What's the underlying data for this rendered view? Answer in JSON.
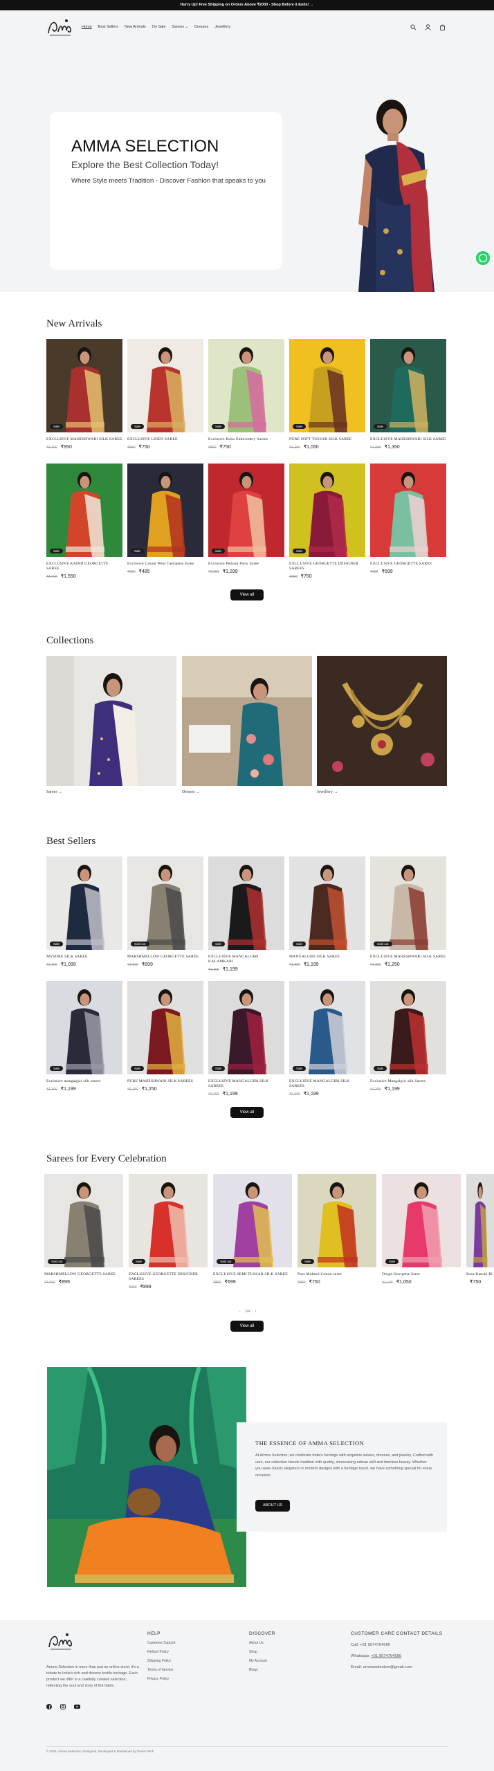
{
  "announcement": "Hurry Up! Free Shipping on Orders Above ₹2000 - Shop Before it Ends! →",
  "header": {
    "logo_text": "Amma Selection",
    "nav": [
      "Home",
      "Best Sellers",
      "New Arrivals",
      "On Sale",
      "Sarees",
      "Dresses",
      "Jewellery"
    ],
    "icons": [
      "search-icon",
      "account-icon",
      "cart-icon"
    ]
  },
  "hero": {
    "title": "AMMA SELECTION",
    "subtitle": "Explore the Best Collection Today!",
    "description": "Where Style meets Tradition - Discover Fashion that speaks to you"
  },
  "new_arrivals": {
    "title": "New Arrivals",
    "view_all": "View all",
    "products": [
      {
        "name": "EXCLUSIVE MAHESHWARI SILK SAREE",
        "old": "₹1,200",
        "price": "₹950",
        "badge": "Sale"
      },
      {
        "name": "EXCLUSIVE LINEN SAREE",
        "old": "₹850",
        "price": "₹750",
        "badge": "Sale"
      },
      {
        "name": "Exclusive Boho Embroidery Sarees",
        "old": "₹850",
        "price": "₹750",
        "badge": "Sale"
      },
      {
        "name": "PURE SOFT TUSSAR SILK SAREE",
        "old": "₹1,200",
        "price": "₹1,050",
        "badge": "Sale"
      },
      {
        "name": "EXCLUSIVE MAHESHWARI SILK SAREE",
        "old": "₹1,550",
        "price": "₹1,350",
        "badge": "Sale"
      },
      {
        "name": "EXCLUSIVE KADDI GEORGETTE SAREE",
        "old": "₹1,700",
        "price": "₹1,550",
        "badge": "Sale"
      },
      {
        "name": "Exclusive Casual Wear Georgette Saree",
        "old": "₹650",
        "price": "₹485",
        "badge": "Sale"
      },
      {
        "name": "Exclusive Pethani Party Saree",
        "old": "₹1,350",
        "price": "₹1,299",
        "badge": "Sale"
      },
      {
        "name": "EXCLUSIVE GEORGETTE DESIGNER SAREES",
        "old": "₹850",
        "price": "₹750",
        "badge": "Sale"
      },
      {
        "name": "EXCLUSIVE GEORGETTE SAREE",
        "old": "₹950",
        "price": "₹699",
        "badge": ""
      }
    ]
  },
  "collections": {
    "title": "Collections",
    "items": [
      "Sarees →",
      "Dresses →",
      "Jewellery →"
    ]
  },
  "best_sellers": {
    "title": "Best Sellers",
    "view_all": "View all",
    "products": [
      {
        "name": "MYSORE SILK SAREE",
        "old": "₹1,200",
        "price": "₹1,099",
        "badge": "Sale"
      },
      {
        "name": "MARSHMELLOW GEORGETTE SAREE",
        "old": "₹1,000",
        "price": "₹899",
        "badge": "Sold out"
      },
      {
        "name": "EXCLUSIVE MANGALGIRI KALAMKARI",
        "old": "₹1,350",
        "price": "₹1,199",
        "badge": "Sale"
      },
      {
        "name": "MANGALGIRI SILK SAREE",
        "old": "₹1,300",
        "price": "₹1,199",
        "badge": "Sale"
      },
      {
        "name": "EXCLUSIVE MAHESHWARI SILK SAREE",
        "old": "₹1,350",
        "price": "₹1,250",
        "badge": "Sold out"
      },
      {
        "name": "Exclusive mangalgiri silk sarees",
        "old": "₹1,300",
        "price": "₹1,199",
        "badge": "Sale"
      },
      {
        "name": "PURE MAHESHWARI SILK SAREES",
        "old": "₹1,350",
        "price": "₹1,250",
        "badge": "Sale"
      },
      {
        "name": "EXCLUSIVE MANGALGIRI SILK SAREES",
        "old": "₹1,300",
        "price": "₹1,199",
        "badge": "Sale"
      },
      {
        "name": "EXCLUSIVE MANGALGIRI SILK SAREES",
        "old": "₹1,300",
        "price": "₹1,199",
        "badge": "Sale"
      },
      {
        "name": "Exclusive Mangalgiri silk Sarees",
        "old": "₹1,300",
        "price": "₹1,199",
        "badge": "Sale"
      }
    ]
  },
  "celebration": {
    "title": "Sarees for Every Celebration",
    "view_all": "View all",
    "pager": "1/4",
    "products": [
      {
        "name": "MARSHMELLOW GEORGETTE SAREE",
        "old": "₹1,000",
        "price": "₹899",
        "badge": "Sold out"
      },
      {
        "name": "EXCLUSIVE GEORGETTE DESIGNER SAREES",
        "old": "₹999",
        "price": "₹899",
        "badge": "Sale"
      },
      {
        "name": "EXCLUSIVE SEMI TUSSAR SILK SAREE",
        "old": "₹850",
        "price": "₹699",
        "badge": "Sold out"
      },
      {
        "name": "Pure Mulmul Cotton saree",
        "old": "₹850",
        "price": "₹750",
        "badge": "Sale"
      },
      {
        "name": "Ornga Georgette Saree",
        "old": "₹1,100",
        "price": "₹1,050",
        "badge": "Sale"
      },
      {
        "name": "Kota Kanchi Bl",
        "old": "",
        "price": "₹750",
        "badge": ""
      }
    ]
  },
  "essence": {
    "title": "THE ESSENCE OF AMMA SELECTION",
    "body": "At Amma Selection, we celebrate India's heritage with exquisite sarees, dresses, and jewelry. Crafted with care, our collection blends tradition with quality, showcasing artisan skill and timeless beauty. Whether you seek classic elegance or modern designs with a heritage touch, we have something special for every occasion.",
    "button": "ABOUT US"
  },
  "footer": {
    "about": "Amma Selection is more than just an online store; it's a tribute to India's rich and diverse textile heritage. Each product we offer is a carefully curated selection, reflecting the soul and story of the fabric.",
    "help_title": "HELP",
    "help_links": [
      "Customer Support",
      "Refund Policy",
      "Shipping Policy",
      "Terms of Service",
      "Privacy Policy"
    ],
    "discover_title": "DISCOVER",
    "discover_links": [
      "About Us",
      "Shop",
      "My Account",
      "Blogs"
    ],
    "contact_title": "CUSTOMER CARE CONTACT DETAILS",
    "call": "Call: +91 9074764566",
    "whatsapp_label": "Whatsapp:",
    "whatsapp": "+91 9074764566",
    "email": "Email: ammaselection@gmail.com",
    "copyright": "© 2024, Amma Selection | Designed, Developed & Maintained by Oneiro Tech"
  },
  "colors": {
    "dark": "#111111",
    "light_bg": "#f3f4f6",
    "whatsapp": "#25d366"
  }
}
